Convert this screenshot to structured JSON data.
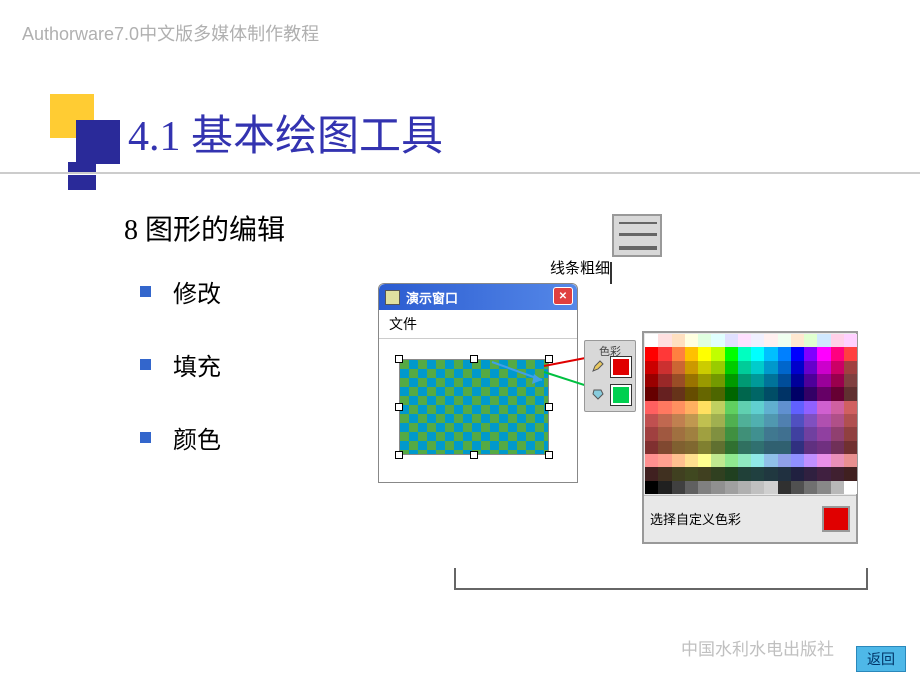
{
  "header": "Authorware7.0中文版多媒体制作教程",
  "section_title": "4.1  基本绘图工具",
  "subtitle": "8  图形的编辑",
  "bullets": [
    "修改",
    "填充",
    "颜色"
  ],
  "line_thickness_label": "线条粗细",
  "demo_window": {
    "title": "演示窗口",
    "menu": "文件"
  },
  "color_tool": {
    "label": "色彩"
  },
  "palette": {
    "custom_label": "选择自定义色彩"
  },
  "publisher": "中国水利水电出版社",
  "back_button": "返回",
  "palette_colors": [
    "#ffffff",
    "#ffe0e0",
    "#ffe0c0",
    "#ffffe0",
    "#e0ffe0",
    "#e0ffff",
    "#e0e0ff",
    "#ffe0ff",
    "#f0f0ff",
    "#fff0f0",
    "#f0fff0",
    "#ffe8d0",
    "#e0ffd0",
    "#d0e8ff",
    "#ffd0e8",
    "#ffd0ff",
    "#ff0000",
    "#ff3838",
    "#ff8040",
    "#ffc000",
    "#ffff00",
    "#c0ff00",
    "#00ff00",
    "#00ffc0",
    "#00ffff",
    "#00c0ff",
    "#0080ff",
    "#0000ff",
    "#8000ff",
    "#ff00ff",
    "#ff0080",
    "#ff4040",
    "#cc0000",
    "#cc3030",
    "#cc6633",
    "#cc9900",
    "#cccc00",
    "#99cc00",
    "#00cc00",
    "#00cc99",
    "#00cccc",
    "#0099cc",
    "#0066cc",
    "#0000cc",
    "#6600cc",
    "#cc00cc",
    "#cc0066",
    "#a04040",
    "#990000",
    "#992828",
    "#994d26",
    "#997300",
    "#999900",
    "#739900",
    "#009900",
    "#009973",
    "#009999",
    "#007399",
    "#004d99",
    "#000099",
    "#4d0099",
    "#990099",
    "#99004d",
    "#804040",
    "#660000",
    "#662020",
    "#663319",
    "#664d00",
    "#666600",
    "#4d6600",
    "#006600",
    "#00664d",
    "#006666",
    "#004d66",
    "#003366",
    "#000066",
    "#330066",
    "#660066",
    "#660033",
    "#603030",
    "#ff6060",
    "#ff7860",
    "#ff9060",
    "#ffb060",
    "#ffe060",
    "#c0d060",
    "#60d060",
    "#60d0b0",
    "#60d0d0",
    "#60b0d0",
    "#6090d0",
    "#6060ff",
    "#9060ff",
    "#d060d0",
    "#d060a0",
    "#d06060",
    "#c05050",
    "#c06850",
    "#c08050",
    "#c09850",
    "#c0c050",
    "#a0b050",
    "#50b050",
    "#50b098",
    "#50b0b0",
    "#5098b0",
    "#5080b0",
    "#5050c0",
    "#8050c0",
    "#b050b0",
    "#b05088",
    "#b05050",
    "#a04040",
    "#a05840",
    "#a07040",
    "#a08040",
    "#a0a040",
    "#809040",
    "#409040",
    "#409078",
    "#409090",
    "#407890",
    "#407090",
    "#4040a0",
    "#7040a0",
    "#9040a0",
    "#904070",
    "#904040",
    "#803030",
    "#804830",
    "#806030",
    "#806830",
    "#808030",
    "#607030",
    "#307030",
    "#307060",
    "#307070",
    "#306070",
    "#306070",
    "#303080",
    "#603080",
    "#703080",
    "#703058",
    "#703030",
    "#ff9090",
    "#ffa090",
    "#ffc090",
    "#ffe090",
    "#ffff90",
    "#c0e890",
    "#90e890",
    "#90e8c0",
    "#90e8e8",
    "#90c0e8",
    "#90a0e8",
    "#9090ff",
    "#c090ff",
    "#e890e8",
    "#e890b8",
    "#e89090",
    "#402020",
    "#403020",
    "#404020",
    "#404820",
    "#404020",
    "#304020",
    "#204020",
    "#204038",
    "#204040",
    "#203840",
    "#203040",
    "#202040",
    "#302040",
    "#402040",
    "#402030",
    "#402020",
    "#000000",
    "#202020",
    "#404040",
    "#606060",
    "#808080",
    "#909090",
    "#a0a0a0",
    "#b0b0b0",
    "#c0c0c0",
    "#d0d0d0",
    "#303030",
    "#505050",
    "#707070",
    "#888888",
    "#b8b8b8",
    "#ffffff"
  ]
}
